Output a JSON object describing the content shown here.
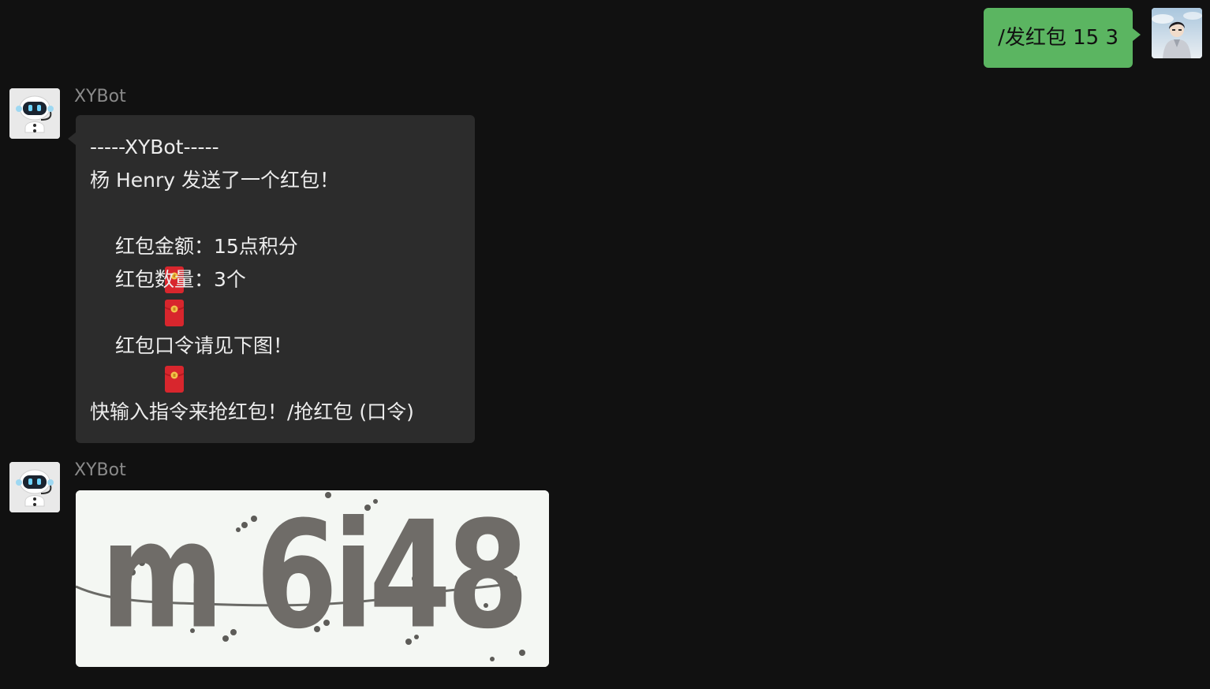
{
  "outgoing": {
    "text": "/发红包 15 3",
    "avatar_icon": "user-avatar"
  },
  "messages": [
    {
      "sender": "XYBot",
      "avatar_icon": "robot-avatar",
      "lines": [
        "-----XYBot-----",
        "杨 Henry 发送了一个红包！",
        "",
        "红包金额：15点积分",
        "红包数量：3个",
        "",
        "红包口令请见下图！",
        "",
        "快输入指令来抢红包！/抢红包 (口令)"
      ],
      "line_icons": [
        "",
        "",
        "",
        "red-envelope-icon",
        "red-envelope-icon",
        "",
        "red-envelope-icon",
        "",
        ""
      ]
    },
    {
      "sender": "XYBot",
      "avatar_icon": "robot-avatar",
      "image": {
        "type": "captcha",
        "glyph_text": "m 6i48"
      }
    }
  ],
  "colors": {
    "background": "#111111",
    "outgoing_bubble": "#5bb561",
    "incoming_bubble": "#2c2c2c",
    "sender_name": "#8a8a8a",
    "captcha_bg": "#f4f7f3",
    "captcha_ink": "#6f6c68"
  }
}
